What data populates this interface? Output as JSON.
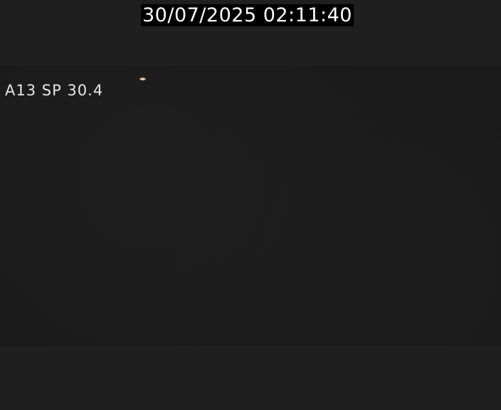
{
  "overlay": {
    "timestamp": "30/07/2025 02:11:40",
    "camera_label": "A13 SP 30.4"
  },
  "colors": {
    "background": "#1f1f1f",
    "video_area": "#1a1a1a",
    "timestamp_bg": "#000000",
    "text": "#ffffff"
  }
}
